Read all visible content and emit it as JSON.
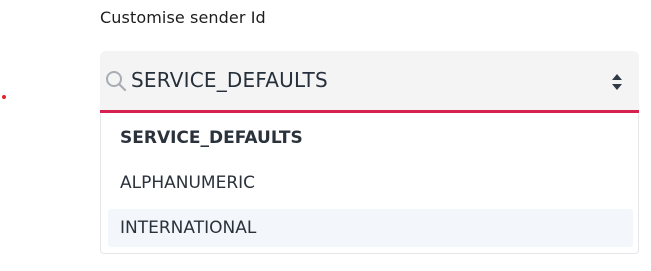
{
  "field": {
    "label": "Customise sender Id"
  },
  "select": {
    "value": "SERVICE_DEFAULTS",
    "search_icon": "search-icon",
    "toggle_icon": "sort-updown-icon"
  },
  "dropdown": {
    "options": [
      {
        "label": "SERVICE_DEFAULTS",
        "selected": true
      },
      {
        "label": "ALPHANUMERIC",
        "selected": false
      },
      {
        "label": "INTERNATIONAL",
        "selected": false,
        "highlighted": true
      }
    ]
  },
  "colors": {
    "accent_underline": "#d62150",
    "indicator_dot": "#e0252f",
    "field_background": "#f4f4f5",
    "highlight_row": "#f3f7fb"
  }
}
